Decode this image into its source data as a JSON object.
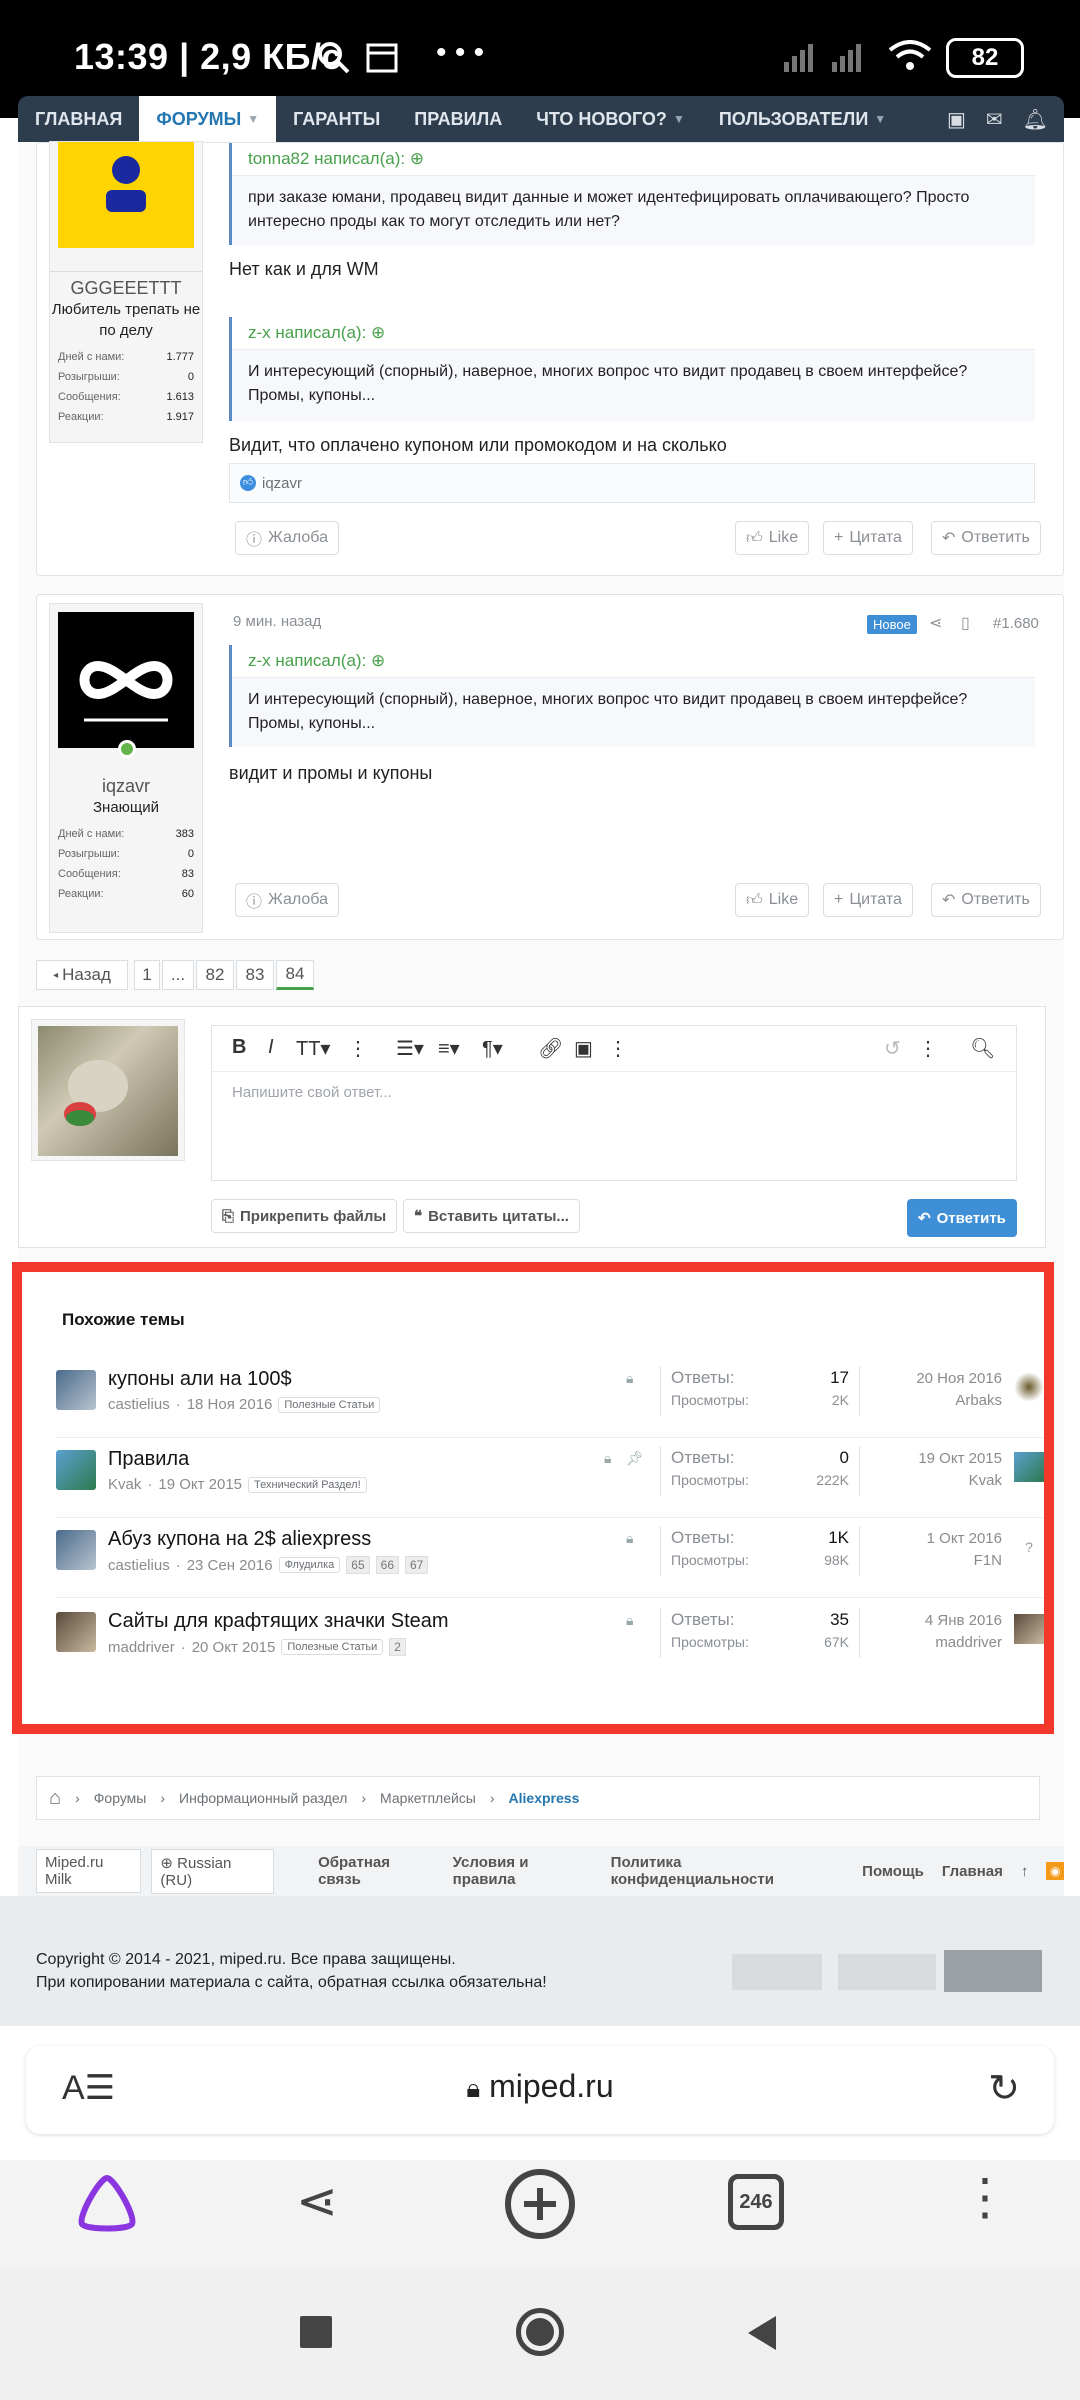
{
  "status": {
    "time": "13:39 | 2,9 КБ/с",
    "battery": "82"
  },
  "nav": {
    "items": [
      "ГЛАВНАЯ",
      "ФОРУМЫ",
      "ГАРАНТЫ",
      "ПРАВИЛА",
      "ЧТО НОВОГО?",
      "ПОЛЬЗОВАТЕЛИ"
    ]
  },
  "post1": {
    "username": "GGGEEETTT",
    "usertitle": "Любитель трепать не по делу",
    "stats": [
      {
        "label": "Дней с нами:",
        "value": "1.777"
      },
      {
        "label": "Розыгрыши:",
        "value": "0"
      },
      {
        "label": "Сообщения:",
        "value": "1.613"
      },
      {
        "label": "Реакции:",
        "value": "1.917"
      }
    ],
    "quote1_header": "tonna82 написал(а):",
    "quote1_body": "при заказе юмани, продавец видит данные и может идентефицировать оплачивающего? Просто интересно проды как то могут отследить или нет?",
    "reply1": "Нет как и для WM",
    "quote2_header": "z-x написал(а):",
    "quote2_body": "И интересующий (спорный), наверное, многих вопрос что видит продавец в своем интерфейсе? Промы, купоны...",
    "reply2": "Видит, что оплачено купоном или промокодом и на сколько",
    "reaction_user": "iqzavr",
    "report": "Жалоба",
    "like": "Like",
    "quote_btn": "Цитата",
    "reply_btn": "Ответить"
  },
  "post2": {
    "time": "9 мин. назад",
    "badge": "Новое",
    "number": "#1.680",
    "username": "iqzavr",
    "usertitle": "Знающий",
    "stats": [
      {
        "label": "Дней с нами:",
        "value": "383"
      },
      {
        "label": "Розыгрыши:",
        "value": "0"
      },
      {
        "label": "Сообщения:",
        "value": "83"
      },
      {
        "label": "Реакции:",
        "value": "60"
      }
    ],
    "quote_header": "z-x написал(а):",
    "quote_body": "И интересующий (спорный), наверное, многих вопрос что видит продавец в своем интерфейсе? Промы, купоны...",
    "reply": "видит и промы и купоны",
    "report": "Жалоба",
    "like": "Like",
    "quote_btn": "Цитата",
    "reply_btn": "Ответить"
  },
  "pagination": {
    "back": "Назад",
    "pages": [
      "1",
      "...",
      "82",
      "83",
      "84"
    ]
  },
  "editor": {
    "placeholder": "Напишите свой ответ...",
    "attach": "Прикрепить файлы",
    "insert_quotes": "Вставить цитаты...",
    "submit": "Ответить"
  },
  "similar": {
    "heading": "Похожие темы",
    "rows": [
      {
        "title": "купоны али на 100$",
        "author": "castielius",
        "date": "18 Ноя 2016",
        "tag": "Полезные Статьи",
        "pages": [],
        "replies_label": "Ответы:",
        "replies": "17",
        "views_label": "Просмотры:",
        "views": "2K",
        "last_date": "20 Ноя 2016",
        "last_user": "Arbaks"
      },
      {
        "title": "Правила",
        "author": "Kvak",
        "date": "19 Окт 2015",
        "tag": "Технический Раздел!",
        "pages": [],
        "replies_label": "Ответы:",
        "replies": "0",
        "views_label": "Просмотры:",
        "views": "222K",
        "last_date": "19 Окт 2015",
        "last_user": "Kvak"
      },
      {
        "title": "Абуз купона на 2$ aliexpress",
        "author": "castielius",
        "date": "23 Сен 2016",
        "tag": "Флудилка",
        "pages": [
          "65",
          "66",
          "67"
        ],
        "replies_label": "Ответы:",
        "replies": "1K",
        "views_label": "Просмотры:",
        "views": "98K",
        "last_date": "1 Окт 2016",
        "last_user": "F1N"
      },
      {
        "title": "Сайты для крафтящих значки Steam",
        "author": "maddriver",
        "date": "20 Окт 2015",
        "tag": "Полезные Статьи",
        "pages": [
          "2"
        ],
        "replies_label": "Ответы:",
        "replies": "35",
        "views_label": "Просмотры:",
        "views": "67K",
        "last_date": "4 Янв 2016",
        "last_user": "maddriver"
      }
    ]
  },
  "breadcrumb": [
    "Форумы",
    "Информационный раздел",
    "Маркетплейсы",
    "Aliexpress"
  ],
  "footer": {
    "style": "Miped.ru Milk",
    "language": "Russian (RU)",
    "links": [
      "Обратная связь",
      "Условия и правила",
      "Политика конфиденциальности",
      "Помощь",
      "Главная"
    ],
    "copyright1": "Copyright © 2014 - 2021, miped.ru. Все права защищены.",
    "copyright2": "При копировании материала с сайта, обратная ссылка обязательна!"
  },
  "browser": {
    "url": "miped.ru",
    "tabs_count": "246"
  },
  "colors": {
    "accent": "#2577b1",
    "red_frame": "#f2382b",
    "nav_bg": "#2e3d4e"
  }
}
